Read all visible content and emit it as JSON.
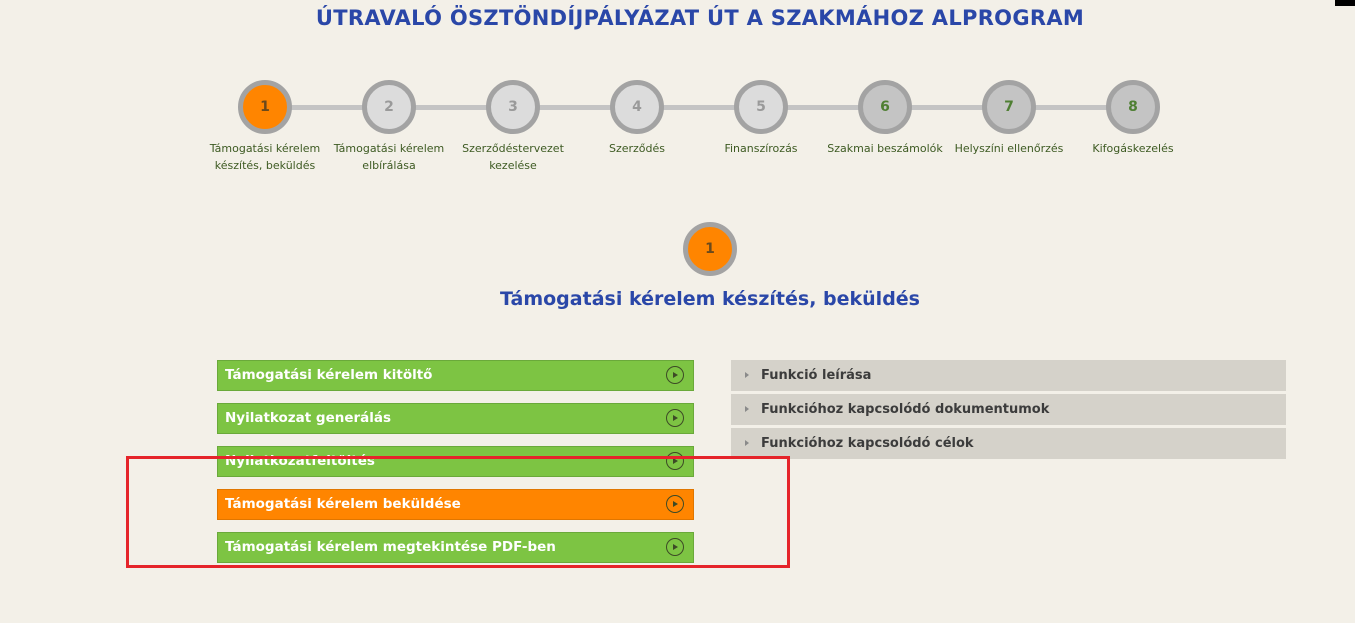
{
  "page": {
    "title": "ÚTRAVALÓ ÖSZTÖNDÍJPÁLYÁZAT ÚT A SZAKMÁHOZ ALPROGRAM"
  },
  "stepper": {
    "steps": [
      {
        "number": "1",
        "label": "Támogatási kérelem készítés, beküldés",
        "state": "active"
      },
      {
        "number": "2",
        "label": "Támogatási kérelem elbírálása",
        "state": "inactive"
      },
      {
        "number": "3",
        "label": "Szerződéstervezet kezelése",
        "state": "inactive"
      },
      {
        "number": "4",
        "label": "Szerződés",
        "state": "inactive"
      },
      {
        "number": "5",
        "label": "Finanszírozás",
        "state": "inactive"
      },
      {
        "number": "6",
        "label": "Szakmai beszámolók",
        "state": "dark"
      },
      {
        "number": "7",
        "label": "Helyszíni ellenőrzés",
        "state": "dark"
      },
      {
        "number": "8",
        "label": "Kifogáskezelés",
        "state": "dark"
      }
    ]
  },
  "current_step": {
    "number": "1",
    "title": "Támogatási kérelem készítés, beküldés"
  },
  "actions": [
    {
      "label": "Támogatási kérelem kitöltő",
      "style": "green"
    },
    {
      "label": "Nyilatkozat generálás",
      "style": "green"
    },
    {
      "label": "Nyilatkozatfeltöltés",
      "style": "green"
    },
    {
      "label": "Támogatási kérelem beküldése",
      "style": "orange"
    },
    {
      "label": "Támogatási kérelem megtekintése PDF-ben",
      "style": "green"
    }
  ],
  "info_panels": [
    {
      "label": "Funkció leírása"
    },
    {
      "label": "Funkcióhoz kapcsolódó dokumentumok"
    },
    {
      "label": "Funkcióhoz kapcsolódó célok"
    }
  ],
  "colors": {
    "background": "#f3f0e8",
    "title_blue": "#2a47a8",
    "active_orange": "#ff8500",
    "action_green": "#7dc443",
    "panel_gray": "#d5d2ca",
    "highlight_red": "#e5242a"
  }
}
